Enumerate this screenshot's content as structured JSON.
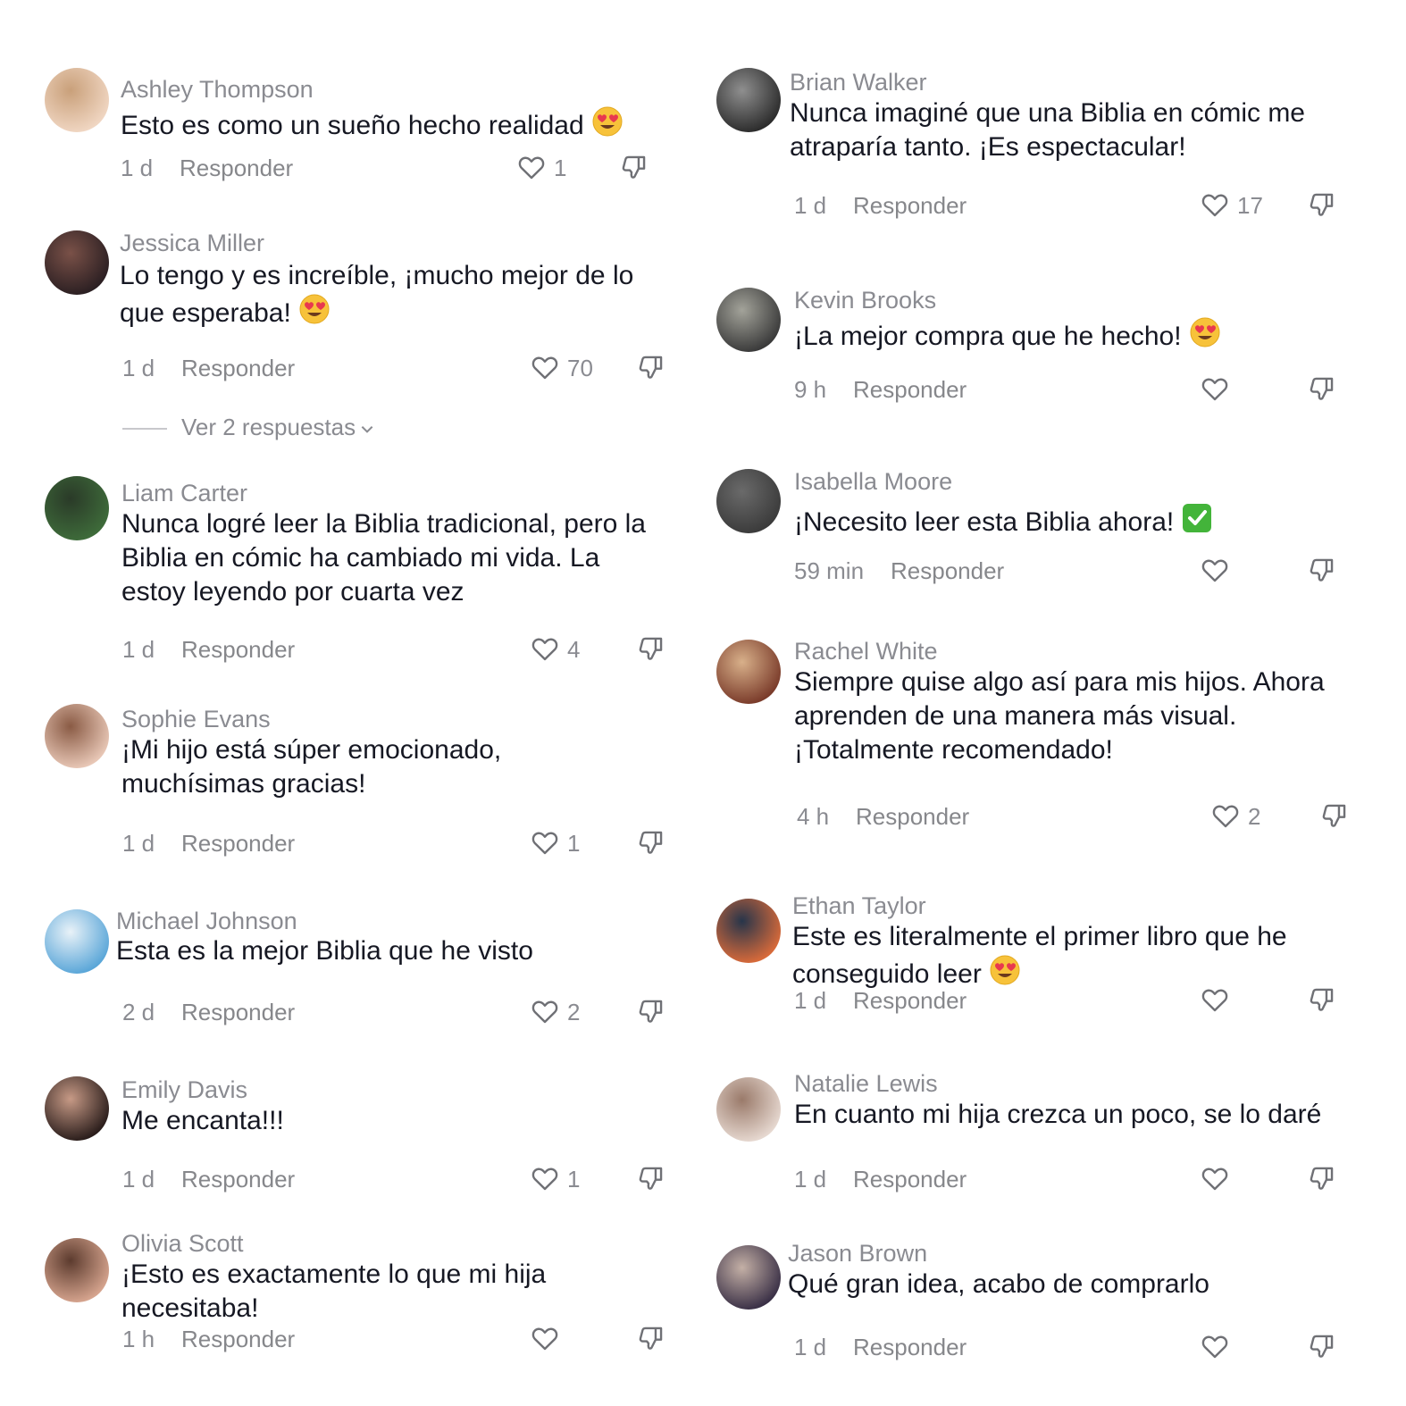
{
  "left": [
    {
      "user": "Ashley Thompson",
      "text": "Esto es como un sueño hecho realidad",
      "emoji": "heart-eyes",
      "time": "1 d",
      "reply": "Responder",
      "likes": "1"
    },
    {
      "user": "Jessica Miller",
      "text": "Lo tengo y es increíble, ¡mucho mejor de lo que esperaba!",
      "emoji": "heart-eyes",
      "time": "1 d",
      "reply": "Responder",
      "likes": "70",
      "view_replies": "Ver 2 respuestas"
    },
    {
      "user": "Liam Carter",
      "text": "Nunca logré leer la Biblia tradicional, pero la Biblia en cómic ha cambiado mi vida. La estoy leyendo por cuarta vez",
      "time": "1 d",
      "reply": "Responder",
      "likes": "4"
    },
    {
      "user": "Sophie Evans",
      "text": "¡Mi hijo está súper emocionado, muchísimas gracias!",
      "time": "1 d",
      "reply": "Responder",
      "likes": "1"
    },
    {
      "user": "Michael Johnson",
      "text": "Esta es la mejor Biblia que he visto",
      "time": "2 d",
      "reply": "Responder",
      "likes": "2"
    },
    {
      "user": "Emily Davis",
      "text": "Me encanta!!!",
      "time": "1 d",
      "reply": "Responder",
      "likes": "1"
    },
    {
      "user": "Olivia Scott",
      "text": "¡Esto es exactamente lo que mi hija necesitaba!",
      "time": "1 h",
      "reply": "Responder",
      "likes": ""
    }
  ],
  "right": [
    {
      "user": "Brian Walker",
      "text": "Nunca imaginé que una Biblia en cómic me atraparía tanto. ¡Es espectacular!",
      "time": "1 d",
      "reply": "Responder",
      "likes": "17"
    },
    {
      "user": "Kevin Brooks",
      "text": "¡La mejor compra que he hecho!",
      "emoji": "heart-eyes",
      "time": "9 h",
      "reply": "Responder",
      "likes": ""
    },
    {
      "user": "Isabella Moore",
      "text": "¡Necesito leer esta Biblia ahora!",
      "emoji": "check-mark",
      "time": "59 min",
      "reply": "Responder",
      "likes": ""
    },
    {
      "user": "Rachel White",
      "text": "Siempre quise algo así para mis hijos. Ahora aprenden de una manera más visual. ¡Totalmente recomendado!",
      "time": "4 h",
      "reply": "Responder",
      "likes": "2"
    },
    {
      "user": "Ethan Taylor",
      "text": "Este es literalmente el primer libro que he conseguido leer",
      "emoji": "heart-eyes",
      "time": "1 d",
      "reply": "Responder",
      "likes": ""
    },
    {
      "user": "Natalie Lewis",
      "text": "En cuanto mi hija crezca un poco, se lo daré",
      "time": "1 d",
      "reply": "Responder",
      "likes": ""
    },
    {
      "user": "Jason Brown",
      "text": "Qué gran idea, acabo de comprarlo",
      "time": "1 d",
      "reply": "Responder",
      "likes": ""
    }
  ],
  "colors": {
    "text": "#161823",
    "muted": "#8a8b91",
    "background": "#ffffff"
  }
}
